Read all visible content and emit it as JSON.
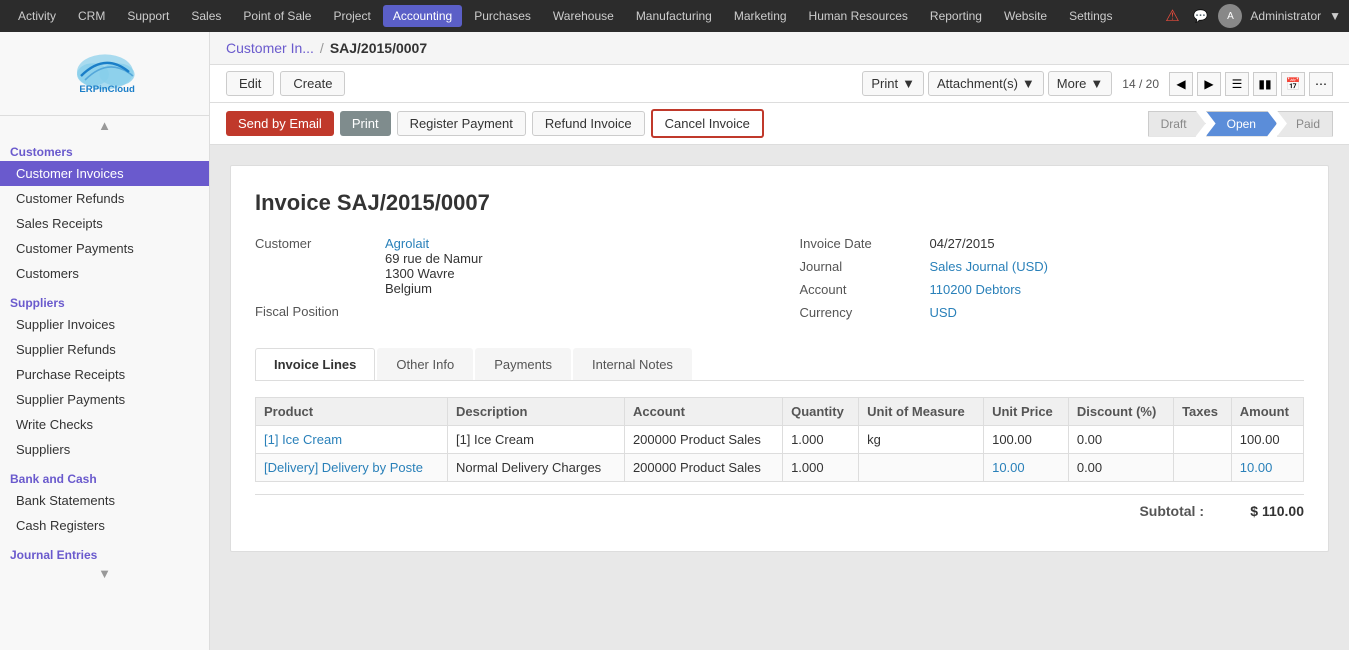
{
  "topnav": {
    "items": [
      {
        "label": "Activity",
        "active": false
      },
      {
        "label": "CRM",
        "active": false
      },
      {
        "label": "Support",
        "active": false
      },
      {
        "label": "Sales",
        "active": false
      },
      {
        "label": "Point of Sale",
        "active": false
      },
      {
        "label": "Project",
        "active": false
      },
      {
        "label": "Accounting",
        "active": true
      },
      {
        "label": "Purchases",
        "active": false
      },
      {
        "label": "Warehouse",
        "active": false
      },
      {
        "label": "Manufacturing",
        "active": false
      },
      {
        "label": "Marketing",
        "active": false
      },
      {
        "label": "Human Resources",
        "active": false
      },
      {
        "label": "Reporting",
        "active": false
      },
      {
        "label": "Website",
        "active": false
      },
      {
        "label": "Settings",
        "active": false
      }
    ],
    "admin_label": "Administrator"
  },
  "sidebar": {
    "customers_section": "Customers",
    "customers_items": [
      {
        "label": "Customer Invoices",
        "active": true
      },
      {
        "label": "Customer Refunds",
        "active": false
      },
      {
        "label": "Sales Receipts",
        "active": false
      },
      {
        "label": "Customer Payments",
        "active": false
      },
      {
        "label": "Customers",
        "active": false
      }
    ],
    "suppliers_section": "Suppliers",
    "suppliers_items": [
      {
        "label": "Supplier Invoices",
        "active": false
      },
      {
        "label": "Supplier Refunds",
        "active": false
      },
      {
        "label": "Purchase Receipts",
        "active": false
      },
      {
        "label": "Supplier Payments",
        "active": false
      },
      {
        "label": "Write Checks",
        "active": false
      },
      {
        "label": "Suppliers",
        "active": false
      }
    ],
    "bank_section": "Bank and Cash",
    "bank_items": [
      {
        "label": "Bank Statements",
        "active": false
      },
      {
        "label": "Cash Registers",
        "active": false
      }
    ],
    "journal_section": "Journal Entries"
  },
  "breadcrumb": {
    "link": "Customer In...",
    "separator": "/",
    "current": "SAJ/2015/0007"
  },
  "toolbar": {
    "edit_label": "Edit",
    "create_label": "Create",
    "print_label": "Print",
    "attachments_label": "Attachment(s)",
    "more_label": "More",
    "pager": "14 / 20"
  },
  "action_bar": {
    "send_email_label": "Send by Email",
    "print_label": "Print",
    "register_payment_label": "Register Payment",
    "refund_invoice_label": "Refund Invoice",
    "cancel_invoice_label": "Cancel Invoice"
  },
  "status": {
    "steps": [
      {
        "label": "Draft",
        "active": false
      },
      {
        "label": "Open",
        "active": true
      },
      {
        "label": "Paid",
        "active": false
      }
    ]
  },
  "invoice": {
    "title": "Invoice SAJ/2015/0007",
    "customer_label": "Customer",
    "customer_name": "Agrolait",
    "customer_address1": "69 rue de Namur",
    "customer_address2": "1300 Wavre",
    "customer_address3": "Belgium",
    "fiscal_position_label": "Fiscal Position",
    "invoice_date_label": "Invoice Date",
    "invoice_date": "04/27/2015",
    "journal_label": "Journal",
    "journal_value": "Sales Journal (USD)",
    "account_label": "Account",
    "account_value": "110200 Debtors",
    "currency_label": "Currency",
    "currency_value": "USD"
  },
  "tabs": [
    {
      "label": "Invoice Lines",
      "active": true
    },
    {
      "label": "Other Info",
      "active": false
    },
    {
      "label": "Payments",
      "active": false
    },
    {
      "label": "Internal Notes",
      "active": false
    }
  ],
  "table": {
    "headers": [
      "Product",
      "Description",
      "Account",
      "Quantity",
      "Unit of Measure",
      "Unit Price",
      "Discount (%)",
      "Taxes",
      "Amount"
    ],
    "rows": [
      {
        "product": "[1] Ice Cream",
        "description": "[1] Ice Cream",
        "account": "200000 Product Sales",
        "quantity": "1.000",
        "uom": "kg",
        "unit_price": "100.00",
        "discount": "0.00",
        "taxes": "",
        "amount": "100.00"
      },
      {
        "product": "[Delivery] Delivery by Poste",
        "description": "Normal Delivery Charges",
        "account": "200000 Product Sales",
        "quantity": "1.000",
        "uom": "",
        "unit_price": "10.00",
        "discount": "0.00",
        "taxes": "",
        "amount": "10.00"
      }
    ]
  },
  "subtotal": {
    "label": "Subtotal :",
    "value": "$ 110.00"
  },
  "colors": {
    "active_nav": "#5b5fc7",
    "sidebar_active": "#6a5acd",
    "btn_red": "#c0392b",
    "link_blue": "#2980b9",
    "status_active": "#5b8dd9"
  }
}
